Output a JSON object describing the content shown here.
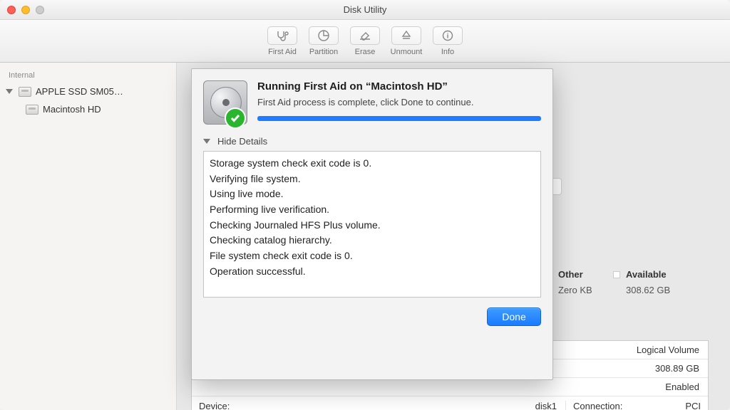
{
  "window": {
    "title": "Disk Utility"
  },
  "toolbar": {
    "first_aid": "First Aid",
    "partition": "Partition",
    "erase": "Erase",
    "unmount": "Unmount",
    "info": "Info"
  },
  "sidebar": {
    "section": "Internal",
    "drive": "APPLE SSD SM05…",
    "volume": "Macintosh HD"
  },
  "background": {
    "other_label": "Other",
    "other_value": "Zero KB",
    "available_label": "Available",
    "available_value": "308.62 GB",
    "row1_l": "",
    "row1_r": "Logical Volume",
    "row2_l": "",
    "row2_r": "308.89 GB",
    "row3_l": "",
    "row3_r": "Enabled",
    "row4_l": "Device:",
    "row4_m": "disk1",
    "row4_c": "Connection:",
    "row4_r": "PCI"
  },
  "sheet": {
    "title": "Running First Aid on “Macintosh HD”",
    "subtitle": "First Aid process is complete, click Done to continue.",
    "toggle": "Hide Details",
    "log": [
      "Storage system check exit code is 0.",
      "Verifying file system.",
      "Using live mode.",
      "Performing live verification.",
      "Checking Journaled HFS Plus volume.",
      "Checking catalog hierarchy.",
      "File system check exit code is 0.",
      "Operation successful."
    ],
    "done": "Done"
  }
}
